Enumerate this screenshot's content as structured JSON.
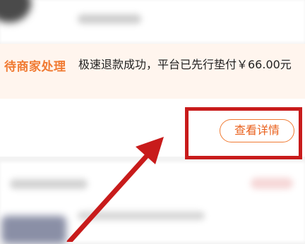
{
  "order_status": {
    "label": "待商家处理",
    "description": "极速退款成功，平台已先行垫付￥66.00元"
  },
  "actions": {
    "detail_button_label": "查看详情"
  },
  "colors": {
    "status_accent": "#f07a32",
    "annotation_red": "#c81b1b"
  }
}
